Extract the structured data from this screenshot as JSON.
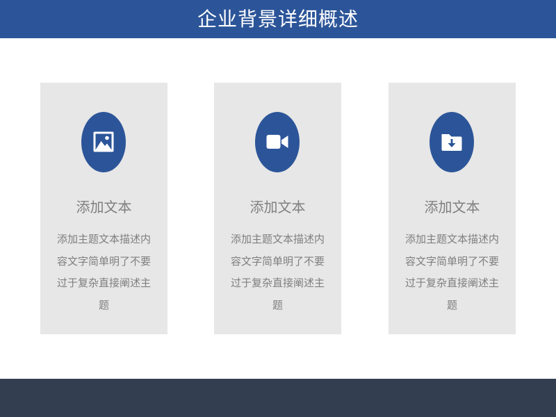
{
  "header": {
    "title": "企业背景详细概述"
  },
  "cards": [
    {
      "icon": "image-icon",
      "title": "添加文本",
      "description": "添加主题文本描述内容文字简单明了不要过于复杂直接阐述主题"
    },
    {
      "icon": "video-camera-icon",
      "title": "添加文本",
      "description": "添加主题文本描述内容文字简单明了不要过于复杂直接阐述主题"
    },
    {
      "icon": "folder-download-icon",
      "title": "添加文本",
      "description": "添加主题文本描述内容文字简单明了不要过于复杂直接阐述主题"
    }
  ],
  "colors": {
    "header_background": "#2c5599",
    "icon_circle": "#2c5599",
    "card_background": "#e7e7e7",
    "card_text": "#7f7f7f",
    "footer_background": "#333f50"
  }
}
